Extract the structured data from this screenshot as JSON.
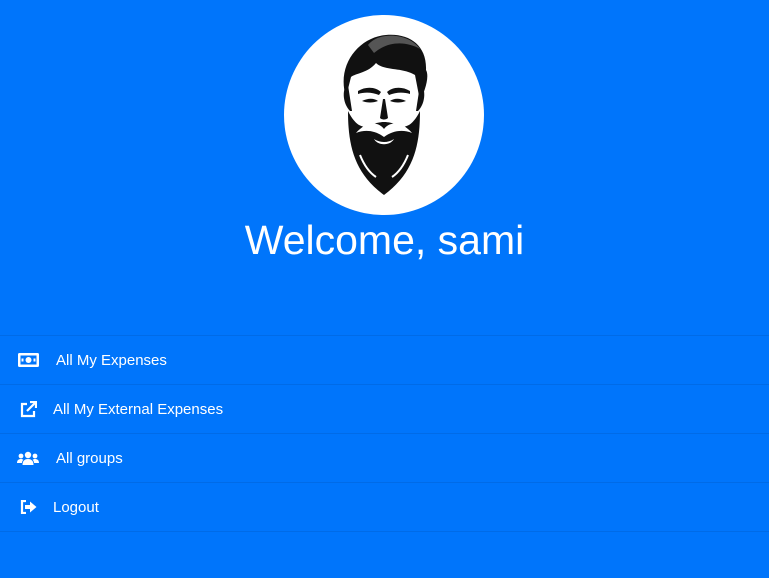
{
  "profile": {
    "avatar_icon": "bearded-man-icon",
    "welcome_text": "Welcome, sami"
  },
  "menu": {
    "items": [
      {
        "label": "All My Expenses",
        "icon": "money-bill-icon"
      },
      {
        "label": "All My External Expenses",
        "icon": "external-link-icon"
      },
      {
        "label": "All groups",
        "icon": "users-icon"
      },
      {
        "label": "Logout",
        "icon": "sign-out-icon"
      }
    ]
  },
  "colors": {
    "background": "#0075fb",
    "text": "#ffffff",
    "avatar_bg": "#ffffff"
  }
}
